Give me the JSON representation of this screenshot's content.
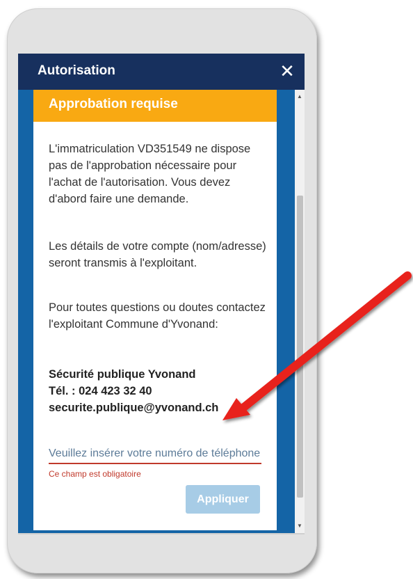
{
  "modal": {
    "title": "Autorisation",
    "close_icon": "close-icon",
    "close_glyph": "✕"
  },
  "card": {
    "heading": "Approbation requise",
    "paragraphs": [
      "L'immatriculation VD351549 ne dispose pas de l'approbation nécessaire pour l'achat de l'autorisation. Vous devez d'abord faire une demande.",
      "Les détails de votre compte (nom/adresse) seront transmis à l'exploitant.",
      "Pour toutes questions ou doutes contactez l'exploitant Commune d'Yvonand:"
    ],
    "contact": {
      "name": "Sécurité publique Yvonand",
      "phone": "Tél. : 024 423 32 40",
      "email": "securite.publique@yvonand.ch"
    },
    "phone_input": {
      "placeholder": "Veuillez insérer votre numéro de téléphone",
      "value": ""
    },
    "error": "Ce champ est obligatoire",
    "apply_label": "Appliquer"
  },
  "scrollbar": {
    "up_glyph": "▲",
    "down_glyph": "▼"
  },
  "annotation": {
    "arrow_icon": "red-arrow-icon"
  },
  "colors": {
    "header": "#17305e",
    "body_bg": "#1464a6",
    "banner": "#f9a912",
    "error": "#c0392b",
    "button_disabled": "#a7cce6",
    "arrow": "#e8201a"
  }
}
